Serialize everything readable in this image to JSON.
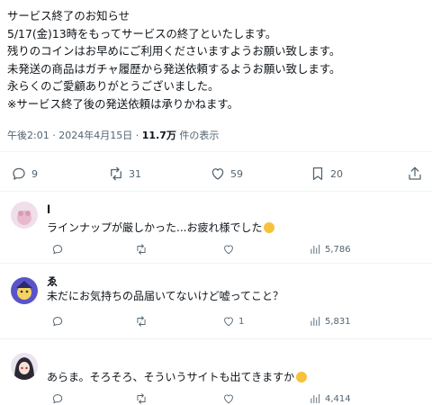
{
  "post": {
    "lines": [
      "サービス終了のお知らせ",
      "5/17(金)13時をもってサービスの終了といたします。",
      "残りのコインはお早めにご利用くださいますようお願い致します。",
      "未発送の商品はガチャ履歴から発送依頼するようお願い致します。",
      "永らくのご愛顧ありがとうございました。",
      "※サービス終了後の発送依頼は承りかねます。"
    ],
    "time": "午後2:01",
    "date": "2024年4月15日",
    "views_count": "11.7万",
    "views_label": "件の表示",
    "stats": {
      "replies": "9",
      "reposts": "31",
      "likes": "59",
      "bookmarks": "20"
    }
  },
  "replies": [
    {
      "name": "l",
      "text": "ラインナップが厳しかった...お疲れ様でした",
      "views": "5,786",
      "likes": "",
      "avatar_color": "#e8d4e4"
    },
    {
      "name": "ゑ",
      "text": "未だにお気持ちの品届いてないけど嘘ってこと？",
      "views": "5,831",
      "likes": "1",
      "avatar_color": "#5a54c9"
    },
    {
      "name": "",
      "text": "あらま。そろそろ、そういうサイトも出てきますか",
      "views": "4,414",
      "likes": "",
      "avatar_color": "#3a3a46"
    }
  ],
  "colors": {
    "text": "#0f1419",
    "muted": "#536471",
    "divider": "#eff3f4",
    "emoji": "#f7c23a"
  },
  "icons": [
    "reply-icon",
    "repost-icon",
    "like-icon",
    "bookmark-icon",
    "share-icon",
    "views-icon"
  ]
}
